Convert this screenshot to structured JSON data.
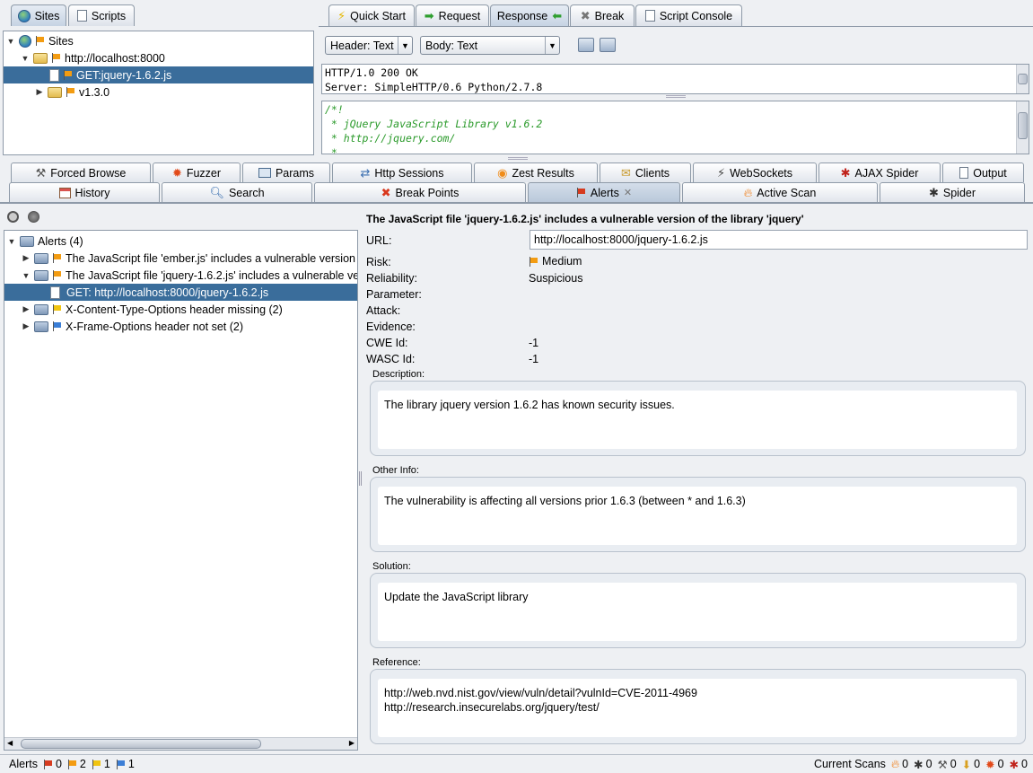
{
  "top_left_tabs": [
    {
      "label": "Sites",
      "selected": true
    },
    {
      "label": "Scripts",
      "selected": false
    }
  ],
  "top_right_tabs": [
    {
      "label": "Quick Start",
      "icon": "lightning-icon"
    },
    {
      "label": "Request",
      "icon": "arrow-right-icon"
    },
    {
      "label": "Response",
      "icon": "arrow-left-icon",
      "selected": true
    },
    {
      "label": "Break",
      "icon": "x-icon"
    },
    {
      "label": "Script Console",
      "icon": "console-icon"
    }
  ],
  "sites_tree": {
    "root": "Sites",
    "host": "http://localhost:8000",
    "selected_item": "GET:jquery-1.6.2.js",
    "folder": "v1.3.0"
  },
  "response": {
    "header_view": "Header: Text",
    "body_view": "Body: Text",
    "header_lines": [
      "HTTP/1.0 200 OK",
      "Server: SimpleHTTP/0.6 Python/2.7.8"
    ],
    "body_lines": [
      "/*!",
      " * jQuery JavaScript Library v1.6.2",
      " * http://jquery.com/",
      " *"
    ]
  },
  "bottom_tabs_row1": [
    "Forced Browse",
    "Fuzzer",
    "Params",
    "Http Sessions",
    "Zest Results",
    "Clients",
    "WebSockets",
    "AJAX Spider",
    "Output"
  ],
  "bottom_tabs_row2": [
    "History",
    "Search",
    "Break Points",
    "Alerts",
    "Active Scan",
    "Spider"
  ],
  "alerts_tree": {
    "root": "Alerts (4)",
    "items": [
      "The JavaScript file 'ember.js' includes a vulnerable version o",
      "The JavaScript file 'jquery-1.6.2.js' includes a vulnerable vers",
      "GET: http://localhost:8000/jquery-1.6.2.js",
      "X-Content-Type-Options header missing (2)",
      "X-Frame-Options header not set (2)"
    ]
  },
  "alert_detail": {
    "title": "The JavaScript file 'jquery-1.6.2.js' includes a vulnerable version of the library 'jquery'",
    "url_label": "URL:",
    "url": "http://localhost:8000/jquery-1.6.2.js",
    "risk_label": "Risk:",
    "risk": "Medium",
    "reliability_label": "Reliability:",
    "reliability": "Suspicious",
    "parameter_label": "Parameter:",
    "attack_label": "Attack:",
    "evidence_label": "Evidence:",
    "cwe_label": "CWE Id:",
    "cwe": "-1",
    "wasc_label": "WASC Id:",
    "wasc": "-1",
    "description_label": "Description:",
    "description": "The library jquery version 1.6.2 has known security issues.",
    "other_info_label": "Other Info:",
    "other_info": "The vulnerability is affecting all versions prior 1.6.3 (between * and 1.6.3)",
    "solution_label": "Solution:",
    "solution": "Update the JavaScript library",
    "reference_label": "Reference:",
    "reference_1": "http://web.nvd.nist.gov/view/vuln/detail?vulnId=CVE-2011-4969",
    "reference_2": "http://research.insecurelabs.org/jquery/test/"
  },
  "status": {
    "alerts_label": "Alerts",
    "high": "0",
    "medium": "2",
    "low": "1",
    "info": "1",
    "current_scans_label": "Current Scans",
    "scans": [
      "0",
      "0",
      "0",
      "0",
      "0",
      "0"
    ]
  },
  "colors": {
    "high": "#d63b1f",
    "medium": "#f39c12",
    "low": "#f1c40f",
    "info": "#3b7ed6",
    "selection": "#3a6d9b"
  }
}
